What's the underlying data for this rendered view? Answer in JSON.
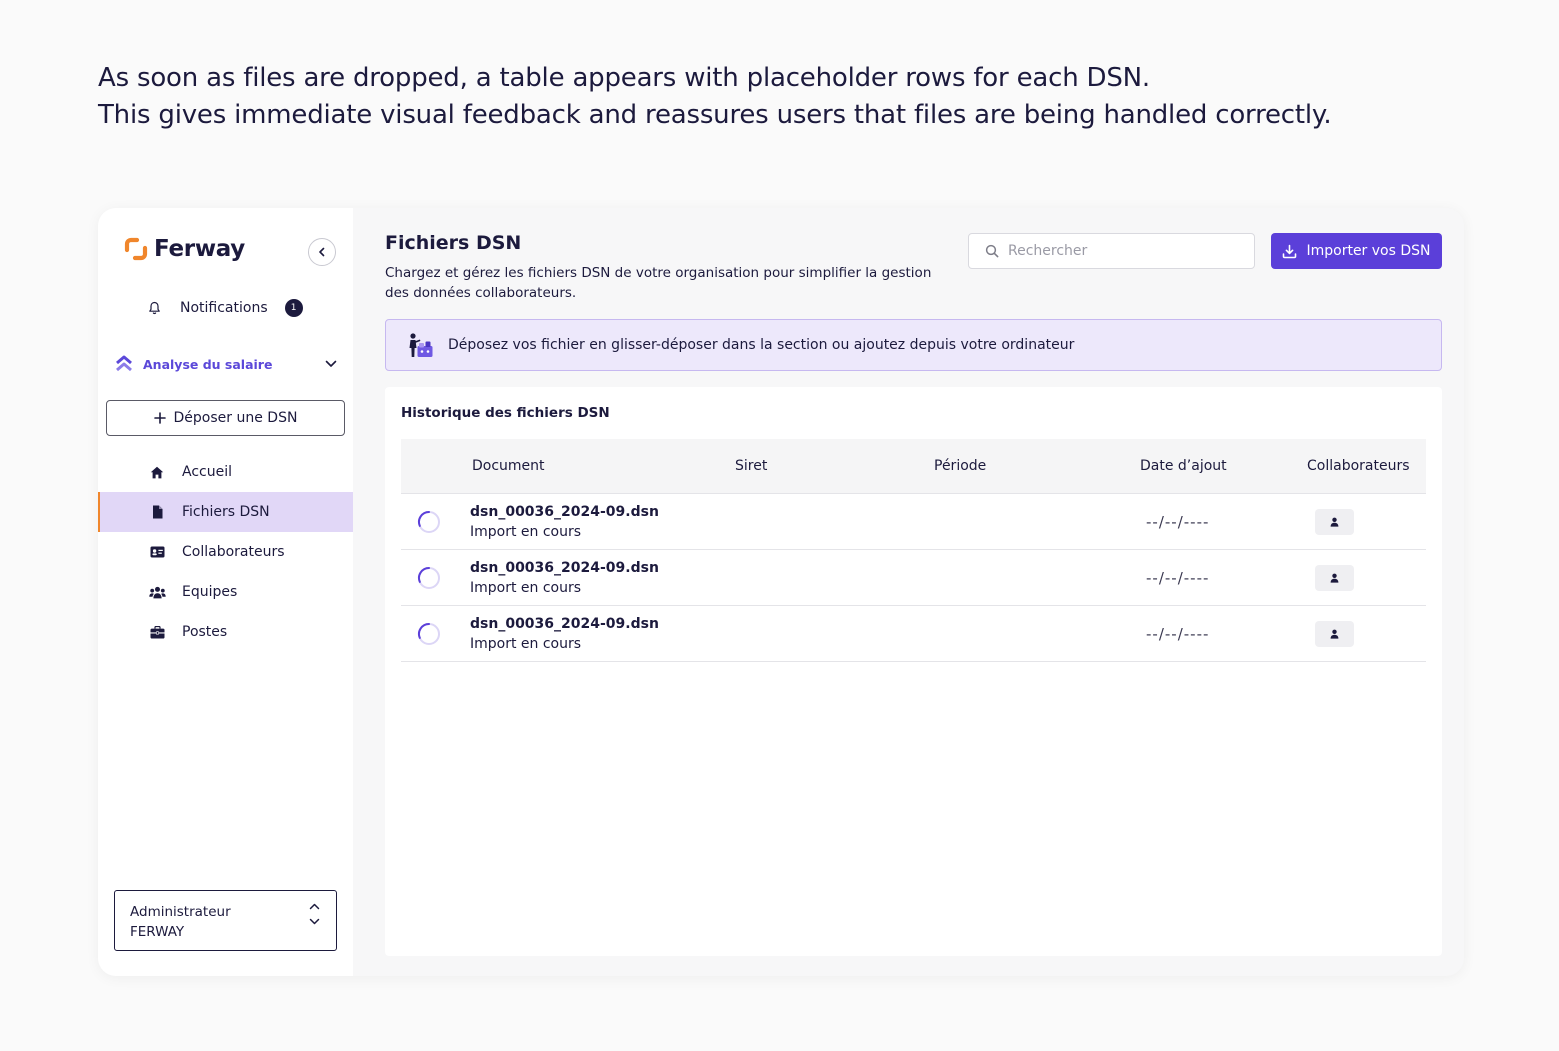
{
  "caption": {
    "line1": "As soon as files are dropped, a table appears with placeholder rows for each DSN.",
    "line2": "This gives immediate visual feedback and reassures users that files are being handled correctly."
  },
  "brand": {
    "name": "Ferway",
    "accent": "#f0862c",
    "primary": "#5b3fd9"
  },
  "sidebar": {
    "notifications": {
      "label": "Notifications",
      "count": "1"
    },
    "module": {
      "label": "Analyse du salaire"
    },
    "deposit_button": "Déposer une DSN",
    "items": [
      {
        "label": "Accueil",
        "icon": "home-icon"
      },
      {
        "label": "Fichiers DSN",
        "icon": "file-icon",
        "active": true
      },
      {
        "label": "Collaborateurs",
        "icon": "id-card-icon"
      },
      {
        "label": "Equipes",
        "icon": "users-icon"
      },
      {
        "label": "Postes",
        "icon": "briefcase-icon"
      }
    ],
    "user": {
      "role": "Administrateur",
      "org": "FERWAY"
    }
  },
  "main": {
    "title": "Fichiers DSN",
    "description": "Chargez et gérez les fichiers DSN de votre organisation pour simplifier la gestion des données collaborateurs.",
    "search": {
      "placeholder": "Rechercher",
      "value": ""
    },
    "import_button": "Importer vos DSN",
    "dropzone": {
      "text": "Déposez vos fichier en glisser-déposer dans la section ou ajoutez depuis votre ordinateur"
    },
    "history": {
      "title": "Historique des fichiers DSN",
      "columns": [
        "Document",
        "Siret",
        "Période",
        "Date d’ajout",
        "Collaborateurs"
      ],
      "rows": [
        {
          "name": "dsn_00036_2024-09.dsn",
          "status": "Import en cours",
          "date": "--/--/----"
        },
        {
          "name": "dsn_00036_2024-09.dsn",
          "status": "Import en cours",
          "date": "--/--/----"
        },
        {
          "name": "dsn_00036_2024-09.dsn",
          "status": "Import en cours",
          "date": "--/--/----"
        }
      ]
    }
  }
}
